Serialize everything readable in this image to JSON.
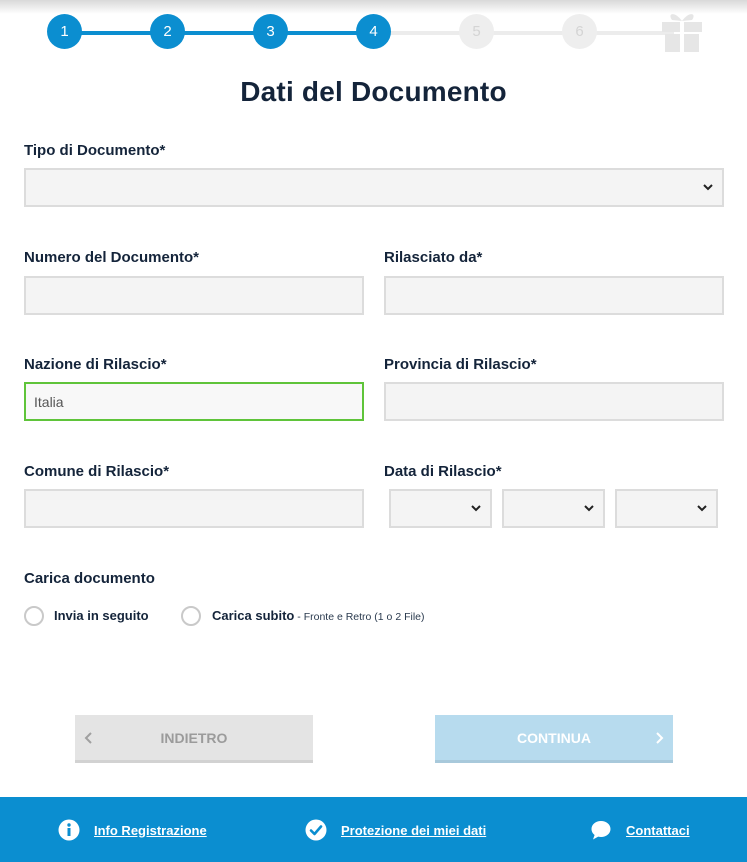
{
  "stepper": {
    "steps": [
      {
        "label": "1",
        "state": "done"
      },
      {
        "label": "2",
        "state": "done"
      },
      {
        "label": "3",
        "state": "done"
      },
      {
        "label": "4",
        "state": "done"
      },
      {
        "label": "5",
        "state": "todo"
      },
      {
        "label": "6",
        "state": "todo"
      }
    ],
    "final_icon": "gift-icon",
    "colors": {
      "done": "#0b8ed0",
      "todo": "#eeeeee"
    }
  },
  "page_title": "Dati del Documento",
  "form": {
    "tipo_documento": {
      "label": "Tipo di Documento*",
      "value": ""
    },
    "numero_documento": {
      "label": "Numero del Documento*",
      "value": ""
    },
    "rilasciato_da": {
      "label": "Rilasciato da*",
      "value": ""
    },
    "nazione_rilascio": {
      "label": "Nazione di Rilascio*",
      "value": "Italia"
    },
    "provincia_rilascio": {
      "label": "Provincia di Rilascio*",
      "value": ""
    },
    "comune_rilascio": {
      "label": "Comune di Rilascio*",
      "value": ""
    },
    "data_rilascio": {
      "label": "Data di Rilascio*",
      "day": "",
      "month": "",
      "year": ""
    }
  },
  "upload": {
    "label": "Carica documento",
    "options": [
      {
        "label": "Invia in seguito",
        "hint": "",
        "selected": false
      },
      {
        "label": "Carica subito",
        "hint": " - Fronte e Retro (1 o 2 File)",
        "selected": false
      }
    ]
  },
  "buttons": {
    "back": "INDIETRO",
    "next": "CONTINUA"
  },
  "footer": {
    "info": "Info Registrazione",
    "privacy": "Protezione dei miei dati",
    "contact": "Contattaci"
  },
  "colors": {
    "accent": "#0b8ed0",
    "active_border": "#5fc43a",
    "title": "#14243a"
  }
}
